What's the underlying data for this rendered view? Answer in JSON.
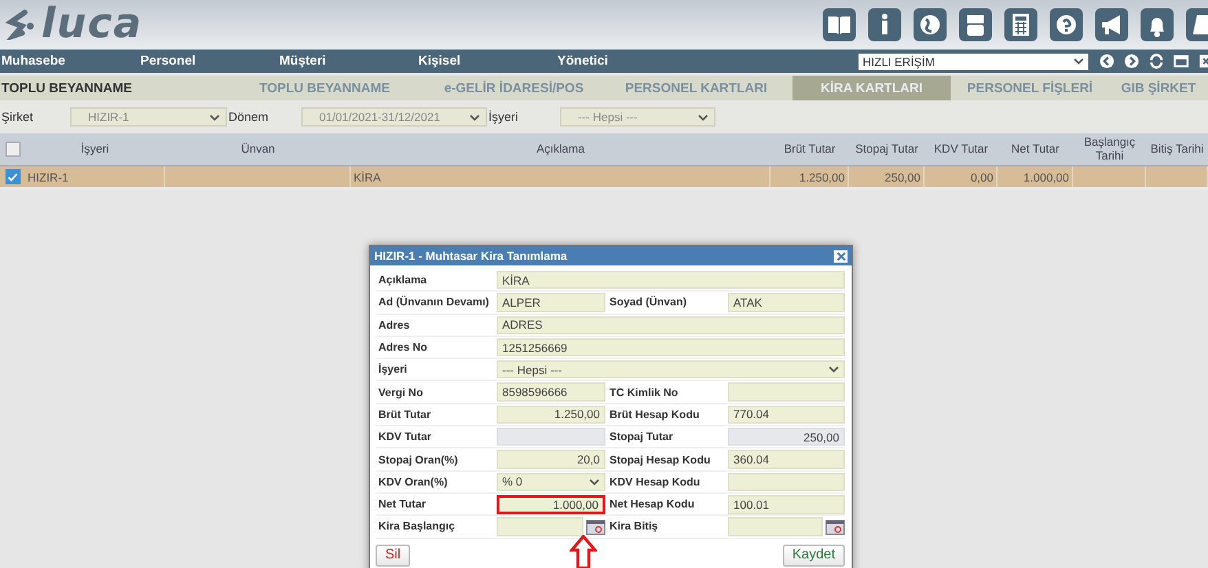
{
  "header": {
    "logo": "luca"
  },
  "nav": {
    "menu": [
      "Muhasebe",
      "Personel",
      "Müşteri",
      "Kişisel",
      "Yönetici"
    ],
    "quick_access": "HIZLI ERİŞİM"
  },
  "tabs": {
    "section": "TOPLU BEYANNAME",
    "items": [
      {
        "label": "TOPLU BEYANNAME",
        "selected": false
      },
      {
        "label": "e-GELİR İDARESİ/POS",
        "selected": false
      },
      {
        "label": "PERSONEL KARTLARI",
        "selected": false
      },
      {
        "label": "KİRA KARTLARI",
        "selected": true
      },
      {
        "label": "PERSONEL FİŞLERİ",
        "selected": false
      },
      {
        "label": "GIB ŞİRKET",
        "selected": false
      }
    ]
  },
  "filters": [
    {
      "label": "Şirket",
      "value": "HIZIR-1"
    },
    {
      "label": "Dönem",
      "value": "01/01/2021-31/12/2021"
    },
    {
      "label": "İşyeri",
      "value": "--- Hepsi ---"
    }
  ],
  "table": {
    "select_all_checked": false,
    "columns": [
      "İşyeri",
      "Ünvan",
      "Açıklama",
      "Brüt Tutar",
      "Stopaj Tutar",
      "KDV Tutar",
      "Net Tutar",
      "Başlangıç Tarihi",
      "Bitiş Tarihi"
    ],
    "rows": [
      {
        "checked": true,
        "selected": true,
        "cells": [
          "HIZIR-1",
          null,
          "KİRA",
          "1.250,00",
          "250,00",
          "0,00",
          "1.000,00",
          null,
          null
        ]
      }
    ]
  },
  "dialog": {
    "title": "HIZIR-1 - Muhtasar Kira Tanımlama",
    "rows": [
      {
        "kind": "full",
        "items": [
          {
            "label": "Açıklama",
            "kind": "text",
            "value": "KİRA",
            "disabled": false,
            "highlighted": false
          }
        ]
      },
      {
        "kind": "pair",
        "items": [
          {
            "label": "Ad (Ünvanın Devamı)",
            "kind": "text",
            "value": "ALPER",
            "disabled": false,
            "highlighted": false
          },
          {
            "label": "Soyad (Ünvan)",
            "kind": "text",
            "value": "ATAK",
            "disabled": false,
            "highlighted": false
          }
        ]
      },
      {
        "kind": "full",
        "items": [
          {
            "label": "Adres",
            "kind": "text",
            "value": "ADRES",
            "disabled": false,
            "highlighted": false
          }
        ]
      },
      {
        "kind": "full",
        "items": [
          {
            "label": "Adres No",
            "kind": "text",
            "value": "1251256669",
            "disabled": false,
            "highlighted": false
          }
        ]
      },
      {
        "kind": "full",
        "items": [
          {
            "label": "İşyeri",
            "kind": "select",
            "value": "--- Hepsi ---",
            "disabled": false,
            "highlighted": false
          }
        ]
      },
      {
        "kind": "pair",
        "items": [
          {
            "label": "Vergi No",
            "kind": "text",
            "value": "8598596666",
            "disabled": false,
            "highlighted": false
          },
          {
            "label": "TC Kimlik No",
            "kind": "text",
            "disabled": false,
            "highlighted": false
          }
        ]
      },
      {
        "kind": "pair",
        "items": [
          {
            "label": "Brüt Tutar",
            "kind": "number",
            "value": "1.250,00",
            "disabled": false,
            "highlighted": false
          },
          {
            "label": "Brüt Hesap Kodu",
            "kind": "text",
            "value": "770.04",
            "disabled": false,
            "highlighted": false
          }
        ]
      },
      {
        "kind": "pair",
        "items": [
          {
            "label": "KDV Tutar",
            "kind": "number",
            "disabled": true,
            "highlighted": false
          },
          {
            "label": "Stopaj Tutar",
            "kind": "number",
            "value": "250,00",
            "disabled": true,
            "highlighted": false
          }
        ]
      },
      {
        "kind": "pair",
        "items": [
          {
            "label": "Stopaj Oran(%)",
            "kind": "number",
            "value": "20,0",
            "disabled": false,
            "highlighted": false
          },
          {
            "label": "Stopaj Hesap Kodu",
            "kind": "text",
            "value": "360.04",
            "disabled": false,
            "highlighted": false
          }
        ]
      },
      {
        "kind": "pair",
        "items": [
          {
            "label": "KDV Oran(%)",
            "kind": "select",
            "value": "% 0",
            "disabled": false,
            "highlighted": false
          },
          {
            "label": "KDV Hesap Kodu",
            "kind": "text",
            "disabled": false,
            "highlighted": false
          }
        ]
      },
      {
        "kind": "pair",
        "items": [
          {
            "label": "Net Tutar",
            "kind": "number",
            "value": "1.000,00",
            "disabled": false,
            "highlighted": true
          },
          {
            "label": "Net Hesap Kodu",
            "kind": "text",
            "value": "100.01",
            "disabled": false,
            "highlighted": false
          }
        ]
      },
      {
        "kind": "pair",
        "items": [
          {
            "label": "Kira Başlangıç",
            "kind": "date",
            "disabled": false,
            "highlighted": false
          },
          {
            "label": "Kira Bitiş",
            "kind": "date",
            "disabled": false,
            "highlighted": false
          }
        ]
      }
    ],
    "buttons": [
      {
        "label": "Sil",
        "kind": "delete"
      },
      {
        "label": "Kaydet",
        "kind": "save"
      }
    ]
  }
}
